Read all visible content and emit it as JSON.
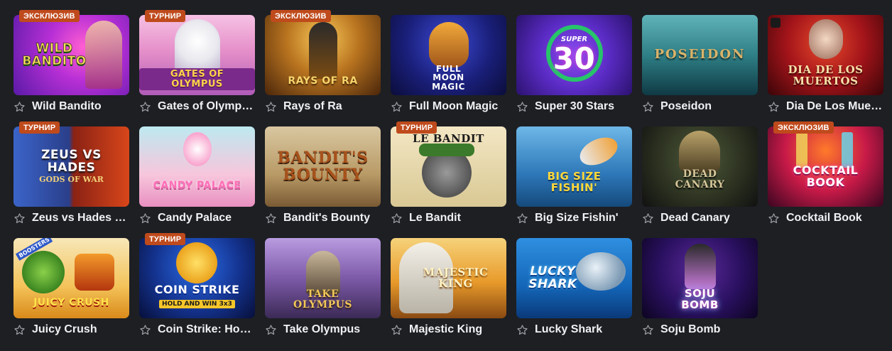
{
  "badges": {
    "exclusive": "ЭКСКЛЮЗИВ",
    "tournament": "ТУРНИР"
  },
  "games": [
    {
      "title": "Wild Bandito",
      "badge": "ЭКСКЛЮЗИВ",
      "art": "WILD BANDITO"
    },
    {
      "title": "Gates of Olympus",
      "badge": "ТУРНИР",
      "art": "GATES of OLYMPUS"
    },
    {
      "title": "Rays of Ra",
      "badge": "ЭКСКЛЮЗИВ",
      "art": "RAYS of RA"
    },
    {
      "title": "Full Moon Magic",
      "badge": "",
      "art": "FULL MOON MAGIC"
    },
    {
      "title": "Super 30 Stars",
      "badge": "",
      "art_top": "SUPER",
      "art": "30"
    },
    {
      "title": "Poseidon",
      "badge": "",
      "art": "POSEIDON"
    },
    {
      "title": "Dia De Los Muertos",
      "badge": "",
      "art": "DIA DE LOS MUERTOS"
    },
    {
      "title": "Zeus vs Hades - Gods of War",
      "badge": "ТУРНИР",
      "art": "ZEUS VS HADES",
      "art_sub": "GODS OF WAR"
    },
    {
      "title": "Candy Palace",
      "badge": "",
      "art": "CANDY PALACE"
    },
    {
      "title": "Bandit's Bounty",
      "badge": "",
      "art": "BANDIT'S BOUNTY"
    },
    {
      "title": "Le Bandit",
      "badge": "ТУРНИР",
      "art": "LE BANDIT"
    },
    {
      "title": "Big Size Fishin'",
      "badge": "",
      "art": "BIG SIZE FISHIN'"
    },
    {
      "title": "Dead Canary",
      "badge": "",
      "art": "DEAD CANARY"
    },
    {
      "title": "Cocktail Book",
      "badge": "ЭКСКЛЮЗИВ",
      "art": "COCKTAIL BOOK"
    },
    {
      "title": "Juicy Crush",
      "badge": "",
      "art_top": "BOOSTERS",
      "art": "JUICY CRUSH"
    },
    {
      "title": "Coin Strike: Hold and Win",
      "badge": "ТУРНИР",
      "art": "COIN STRIKE",
      "art_sub": "HOLD AND WIN 3x3"
    },
    {
      "title": "Take Olympus",
      "badge": "",
      "art": "TAKE OLYMPUS"
    },
    {
      "title": "Majestic King",
      "badge": "",
      "art": "MAJESTIC KING"
    },
    {
      "title": "Lucky Shark",
      "badge": "",
      "art": "LUCKY SHARK"
    },
    {
      "title": "Soju Bomb",
      "badge": "",
      "art": "SOJU BOMB"
    }
  ],
  "colors": {
    "background": "#1d1f23",
    "badge": "#bf4a1c",
    "title": "#f1f1f3",
    "star": "#9a9ca3"
  }
}
